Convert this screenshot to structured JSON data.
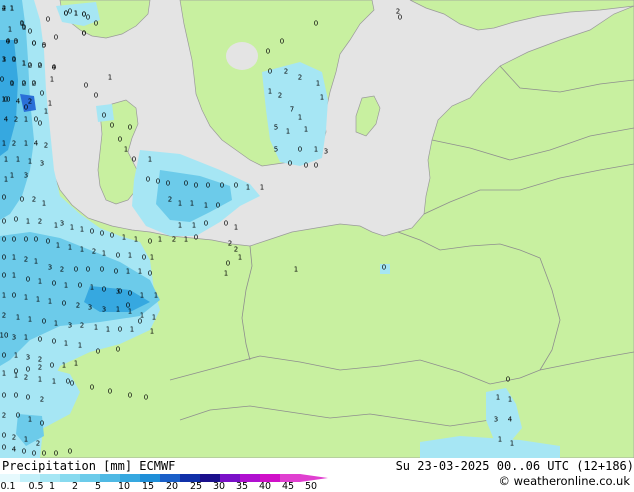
{
  "map": {
    "land_color": "#c8f0a0",
    "sea_color": "#e4e4e4",
    "border_color": "#9a9a9a",
    "precip_light": "#a6e6f4",
    "precip_medium": "#6ccbea",
    "precip_heavy": "#36a8e0",
    "precip_intense": "#2a6fd8",
    "values": [
      "0",
      "1",
      "0",
      "0",
      "4",
      "1",
      "0",
      "1",
      "4",
      "3",
      "0",
      "5",
      "3",
      "0",
      "1",
      "2",
      "0",
      "4",
      "1",
      "2",
      "2",
      "10",
      "4",
      "2",
      "0",
      "4",
      "2",
      "1",
      "0",
      "1",
      "2",
      "1",
      "4",
      "2",
      "1",
      "1",
      "1",
      "3",
      "1",
      "3",
      "0",
      "0",
      "0",
      "0",
      "1",
      "0",
      "1",
      "0",
      "0",
      "0",
      "0",
      "0",
      "0",
      "0",
      "0",
      "1",
      "1",
      "2",
      "1",
      "1",
      "1",
      "0",
      "0",
      "0",
      "1",
      "1",
      "1",
      "0",
      "0",
      "2",
      "1",
      "1",
      "3",
      "1",
      "1",
      "0",
      "0",
      "0",
      "1",
      "1",
      "0",
      "1",
      "2",
      "1",
      "0",
      "0",
      "0",
      "1",
      "2",
      "0",
      "0",
      "0",
      "0",
      "0",
      "1",
      "1",
      "1",
      "2",
      "1",
      "0",
      "1",
      "0",
      "1",
      "0",
      "1",
      "2",
      "1",
      "3",
      "2",
      "0",
      "0",
      "0",
      "0",
      "1",
      "1",
      "0",
      "0",
      "1",
      "0",
      "1",
      "0",
      "1",
      "0",
      "1",
      "0",
      "3",
      "0",
      "1",
      "1",
      "1",
      "0",
      "1",
      "1",
      "1",
      "0",
      "2",
      "3",
      "3",
      "1",
      "1",
      "1",
      "1",
      "2",
      "1",
      "1",
      "0",
      "1",
      "3",
      "2",
      "1",
      "1",
      "0",
      "1",
      "10",
      "3",
      "1",
      "0",
      "0",
      "1",
      "1",
      "0",
      "1",
      "3",
      "2",
      "1",
      "1",
      "2",
      "1",
      "1",
      "0",
      "0",
      "0",
      "0",
      "2",
      "2",
      "0",
      "1",
      "0",
      "0",
      "2",
      "1",
      "2",
      "0",
      "1",
      "1",
      "3",
      "4",
      "1",
      "1",
      "1",
      "2",
      "2",
      "7",
      "1",
      "1",
      "1",
      "3",
      "5",
      "1",
      "0",
      "0",
      "2",
      "1",
      "1",
      "5",
      "0",
      "0",
      "0",
      "2",
      "2",
      "0",
      "1",
      "0",
      "1",
      "1",
      "0",
      "1",
      "0",
      "0",
      "0",
      "0",
      "1",
      "1",
      "1",
      "0",
      "0",
      "0",
      "0",
      "0",
      "0",
      "0",
      "0",
      "2",
      "0",
      "1",
      "0",
      "1",
      "0",
      "0",
      "0",
      "1",
      "0",
      "0",
      "1",
      "1",
      "0",
      "2",
      "0",
      "0",
      "0",
      "0",
      "0",
      "0",
      "0",
      "0",
      "4",
      "0",
      "0",
      "0",
      "0",
      "0",
      "0",
      "1",
      "0",
      "0",
      "2",
      "1",
      "1",
      "0",
      "0",
      "0",
      "0",
      "0",
      "1",
      "1",
      "1",
      "0",
      "2",
      "0",
      "0",
      "0",
      "0",
      "0"
    ]
  },
  "legend": {
    "title": "Precipitation [mm] ECMWF",
    "ticks": [
      "0.1",
      "0.5",
      "1",
      "2",
      "5",
      "10",
      "15",
      "20",
      "25",
      "30",
      "35",
      "40",
      "45",
      "50"
    ],
    "colors": [
      "#e6f9fd",
      "#c2f0fa",
      "#a6e6f4",
      "#88daef",
      "#6ccbea",
      "#4fb9e4",
      "#36a8e0",
      "#1f8fd8",
      "#1a5fc8",
      "#1030a8",
      "#1a0f8c",
      "#7a10c8",
      "#b010d0",
      "#d010c8",
      "#e040d0"
    ]
  },
  "valid_time": "Su 23-03-2025 00..06 UTC (12+186)",
  "credit": "© weatheronline.co.uk"
}
